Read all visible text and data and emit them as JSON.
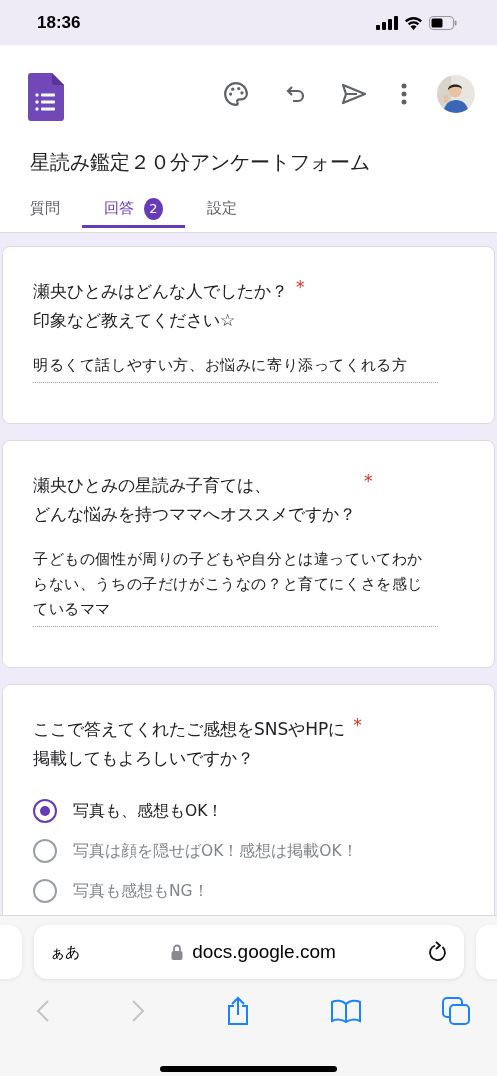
{
  "status_bar": {
    "time": "18:36"
  },
  "form": {
    "title": "星読み鑑定２０分アンケートフォーム"
  },
  "tabs": [
    {
      "label": "質問",
      "selected": false
    },
    {
      "label": "回答",
      "selected": true,
      "count": "2"
    },
    {
      "label": "設定",
      "selected": false
    }
  ],
  "questions": [
    {
      "kind": "text",
      "question_lines": [
        "瀬央ひとみはどんな人でしたか？",
        "印象など教えてください☆"
      ],
      "required_mark": "*",
      "answer": "明るくて話しやすい方、お悩みに寄り添ってくれる方"
    },
    {
      "kind": "text",
      "question_lines": [
        "瀬央ひとみの星読み子育ては、",
        "どんな悩みを持つママへオススメですか？"
      ],
      "required_mark": "*",
      "answer": "子どもの個性が周りの子どもや自分とは違っていてわからない、うちの子だけがこうなの？と育てにくさを感じているママ"
    },
    {
      "kind": "choice",
      "question_lines": [
        "ここで答えてくれたご感想をSNSやHPに",
        "掲載してもよろしいですか？"
      ],
      "required_mark": "*",
      "options": [
        {
          "label": "写真も、感想もOK！",
          "selected": true
        },
        {
          "label": "写真は顔を隠せばOK！感想は掲載OK！",
          "selected": false
        },
        {
          "label": "写真も感想もNG！",
          "selected": false
        }
      ]
    }
  ],
  "browser": {
    "text_size": "ぁあ",
    "url": "docs.google.com"
  }
}
